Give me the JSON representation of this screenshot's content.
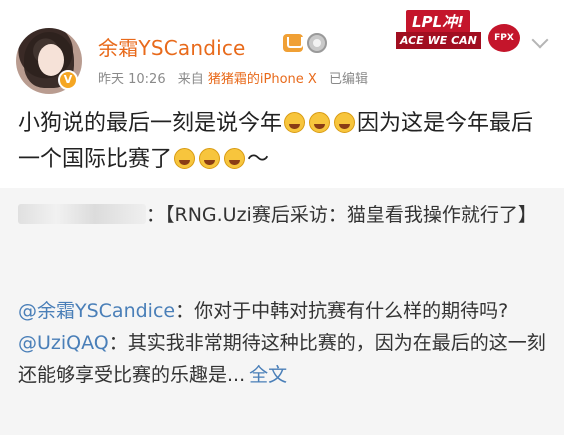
{
  "post": {
    "username": "余霜YSCandice",
    "meta_time": "昨天 10:26",
    "meta_from": "来自",
    "meta_source": "猪猪霜的iPhone X",
    "meta_edited": "已编辑",
    "text_part1": "小狗说的最后一刻是说今年",
    "text_part2": "因为这是今年最后一个国际比赛了",
    "text_part3": "～",
    "emoji_icon": "laugh-cry-emoji"
  },
  "badge": {
    "top": "LPL冲!",
    "bottom": "ACE WE CAN",
    "logo": "FPX"
  },
  "repost": {
    "title": "：【RNG.Uzi赛后采访：猫皇看我操作就行了】",
    "q_mention": "@余霜YSCandice",
    "q_text": "：你对于中韩对抗赛有什么样的期待吗?",
    "a_mention": "@UziQAQ",
    "a_text": "：其实我非常期待这种比赛的，因为在最后的这一刻还能够享受比赛的乐趣是...",
    "full_text_link": "全文"
  },
  "colors": {
    "username": "#e86a1b",
    "link": "#4a7fb8",
    "repost_bg": "#f5f5f5"
  }
}
